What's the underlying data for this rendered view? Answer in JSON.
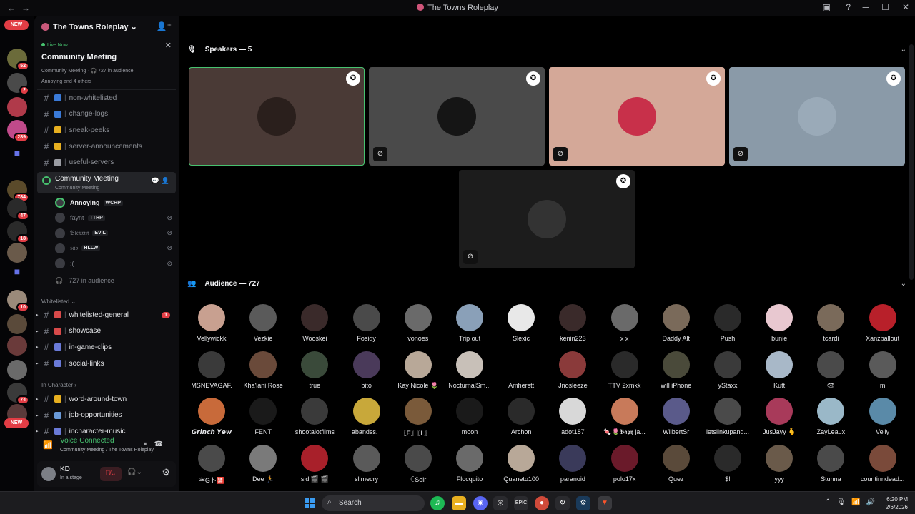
{
  "window": {
    "title": "The Towns Roleplay"
  },
  "rail": {
    "new_label": "NEW",
    "servers": [
      {
        "badge": "52",
        "color": "#6b6b3a"
      },
      {
        "badge": "2",
        "color": "#4a4a4a"
      },
      {
        "badge": "",
        "color": "#b03a4a"
      },
      {
        "badge": "289",
        "color": "#c04a8a"
      },
      {
        "badge": "784",
        "color": "#5a4a2a"
      },
      {
        "badge": "47",
        "color": "#2a2a2a"
      },
      {
        "badge": "18",
        "color": "#2a2a2a"
      },
      {
        "badge": "",
        "color": "#6a5a4a"
      },
      {
        "badge": "10",
        "color": "#9a8a7a"
      },
      {
        "badge": "",
        "color": "#5a4a3a"
      },
      {
        "badge": "",
        "color": "#6a3a3a"
      },
      {
        "badge": "",
        "color": "#6a6a6a"
      },
      {
        "badge": "74",
        "color": "#3a3a3a"
      },
      {
        "badge": "",
        "color": "#5a3a3a"
      }
    ]
  },
  "sidebar": {
    "guild_name": "The Towns Roleplay ⌄",
    "live": {
      "tag": "Live Now",
      "title": "Community Meeting",
      "meta": "Community Meeting · 🎧 727 in audience",
      "speakers": "Annoying and 4 others"
    },
    "channels_top": [
      {
        "name": "non-whitelisted",
        "emoji_color": "#3a7ad8"
      },
      {
        "name": "change-logs",
        "emoji_color": "#3a7ad8"
      },
      {
        "name": "sneak-peeks",
        "emoji_color": "#e8b020"
      },
      {
        "name": "server-announcements",
        "emoji_color": "#e8b020"
      },
      {
        "name": "useful-servers",
        "emoji_color": "#9a9ca3"
      }
    ],
    "stage": {
      "name": "Community Meeting",
      "sub": "Community Meeting"
    },
    "stage_users": [
      {
        "name": "Annoying",
        "tag": "WCRP",
        "muted": false
      },
      {
        "name": "faynt",
        "tag": "TTRP",
        "muted": true
      },
      {
        "name": "𝔅𝔩𝔢𝔵𝔵𝔦𝔫",
        "tag": "EVIL",
        "muted": true
      },
      {
        "name": "𝔰𝔞𝔟",
        "tag": "HLLW",
        "muted": true
      },
      {
        "name": ":(",
        "tag": "",
        "muted": true
      }
    ],
    "audience_count": "727 in audience",
    "cat_whitelisted": "Whitelisted ⌄",
    "channels_whitelisted": [
      {
        "name": "whitelisted-general",
        "emoji_color": "#d84a4a",
        "unread": "1"
      },
      {
        "name": "showcase",
        "emoji_color": "#d84a4a",
        "unread": ""
      },
      {
        "name": "in-game-clips",
        "emoji_color": "#6a7ad8",
        "unread": ""
      },
      {
        "name": "social-links",
        "emoji_color": "#6a7ad8",
        "unread": ""
      }
    ],
    "cat_incharacter": "In Character ›",
    "channels_incharacter": [
      {
        "name": "word-around-town",
        "emoji_color": "#e8b020"
      },
      {
        "name": "job-opportunities",
        "emoji_color": "#6a9ad8"
      },
      {
        "name": "incharacter-music",
        "emoji_color": "#6a7ad8"
      }
    ],
    "voice": {
      "status": "Voice Connected",
      "location": "Community Meeting / The Towns Roleplay"
    },
    "user": {
      "name": "KD",
      "status": "In a stage"
    }
  },
  "stage": {
    "speakers_header": "Speakers — 5",
    "audience_header": "Audience — 727",
    "speakers": [
      {
        "bg": "#4a3a36",
        "av": "#2a1f1c",
        "muted": false,
        "active": true
      },
      {
        "bg": "#4a4a4a",
        "av": "#151515",
        "muted": true,
        "active": false
      },
      {
        "bg": "#d4a898",
        "av": "#c8304a",
        "muted": true,
        "active": false
      },
      {
        "bg": "#8a9aa8",
        "av": "#9aaab8",
        "muted": true,
        "active": false
      },
      {
        "bg": "#1c1c1c",
        "av": "#333333",
        "muted": true,
        "active": false
      }
    ],
    "audience": [
      {
        "name": "Vellywickk",
        "c": "#c8a090"
      },
      {
        "name": "Vezkie",
        "c": "#5a5a5a"
      },
      {
        "name": "Wooskei",
        "c": "#3a2a2a"
      },
      {
        "name": "Fosidy",
        "c": "#4a4a4a"
      },
      {
        "name": "vonoes",
        "c": "#6a6a6a"
      },
      {
        "name": "Trip out",
        "c": "#8aa0b8"
      },
      {
        "name": "Slexic",
        "c": "#e8e8e8"
      },
      {
        "name": "kenin223",
        "c": "#3a2a2a"
      },
      {
        "name": "x x",
        "c": "#6a6a6a"
      },
      {
        "name": "Daddy Alt",
        "c": "#7a6a5a"
      },
      {
        "name": "Push",
        "c": "#2a2a2a"
      },
      {
        "name": "bunie",
        "c": "#e8c8d0"
      },
      {
        "name": "tcardi",
        "c": "#7a6a5a"
      },
      {
        "name": "Xanzballout",
        "c": "#b8202a"
      },
      {
        "name": "MSNEVAGAF.",
        "c": "#3a3a3a"
      },
      {
        "name": "Kha'lani Rose",
        "c": "#6a4a3a"
      },
      {
        "name": "true",
        "c": "#3a4a3a"
      },
      {
        "name": "bito",
        "c": "#4a3a5a"
      },
      {
        "name": "Kay Nicole 🌷",
        "c": "#b8a898"
      },
      {
        "name": "NocturnalSm...",
        "c": "#c8c0b8"
      },
      {
        "name": "Amherstt",
        "c": "#000000"
      },
      {
        "name": "Jnosleeze",
        "c": "#8a3a3a"
      },
      {
        "name": "TTV 2xmkk",
        "c": "#2a2a2a"
      },
      {
        "name": "will iPhone",
        "c": "#4a4a3a"
      },
      {
        "name": "yStaxx",
        "c": "#3a3a3a"
      },
      {
        "name": "Kutt",
        "c": "#a8b8c8"
      },
      {
        "name": "👁",
        "c": "#4a4a4a"
      },
      {
        "name": "m",
        "c": "#5a5a5a"
      },
      {
        "name": "𝙂𝙧𝙞𝙣𝙘𝙝 𝙔𝙚𝙬",
        "c": "#c86a3a"
      },
      {
        "name": "FENT",
        "c": "#1a1a1a"
      },
      {
        "name": "shootalotfilms",
        "c": "#3a3a3a"
      },
      {
        "name": "abandss._",
        "c": "#c8a83a"
      },
      {
        "name": "〖E〗〖L〗...",
        "c": "#7a5a3a"
      },
      {
        "name": "moon",
        "c": "#1a1a1a"
      },
      {
        "name": "Archon",
        "c": "#2a2a2a"
      },
      {
        "name": "adot187",
        "c": "#d8d8d8"
      },
      {
        "name": "🍬🌷𝕭𝖆𝖇𝖞 ja...",
        "c": "#c87a5a"
      },
      {
        "name": "WilbertSr",
        "c": "#5a5a8a"
      },
      {
        "name": "letslinkupand...",
        "c": "#4a4a4a"
      },
      {
        "name": "JusJayy 🫰",
        "c": "#a83a5a"
      },
      {
        "name": "ZayLeaux",
        "c": "#9ab8c8"
      },
      {
        "name": "Velly",
        "c": "#5a8aa8"
      },
      {
        "name": "字G卜🈲",
        "c": "#4a4a4a"
      },
      {
        "name": "Dee 🏃",
        "c": "#7a7a7a"
      },
      {
        "name": "sid 🎬 🎬",
        "c": "#a8202a"
      },
      {
        "name": "slimecry",
        "c": "#5a5a5a"
      },
      {
        "name": "ꉔSolr",
        "c": "#4a4a4a"
      },
      {
        "name": "Flocquito",
        "c": "#6a6a6a"
      },
      {
        "name": "Quaneto100",
        "c": "#b8a898"
      },
      {
        "name": "paranoid",
        "c": "#3a3a5a"
      },
      {
        "name": "polo17x",
        "c": "#6a1a2a"
      },
      {
        "name": "Quez",
        "c": "#5a4a3a"
      },
      {
        "name": "$!",
        "c": "#2a2a2a"
      },
      {
        "name": "yyy",
        "c": "#6a5a4a"
      },
      {
        "name": "Stunna",
        "c": "#4a4a4a"
      },
      {
        "name": "countinndead...",
        "c": "#7a4a3a"
      }
    ]
  },
  "taskbar": {
    "search": "Search",
    "time": "6:20 PM",
    "date": "2/6/2026"
  }
}
